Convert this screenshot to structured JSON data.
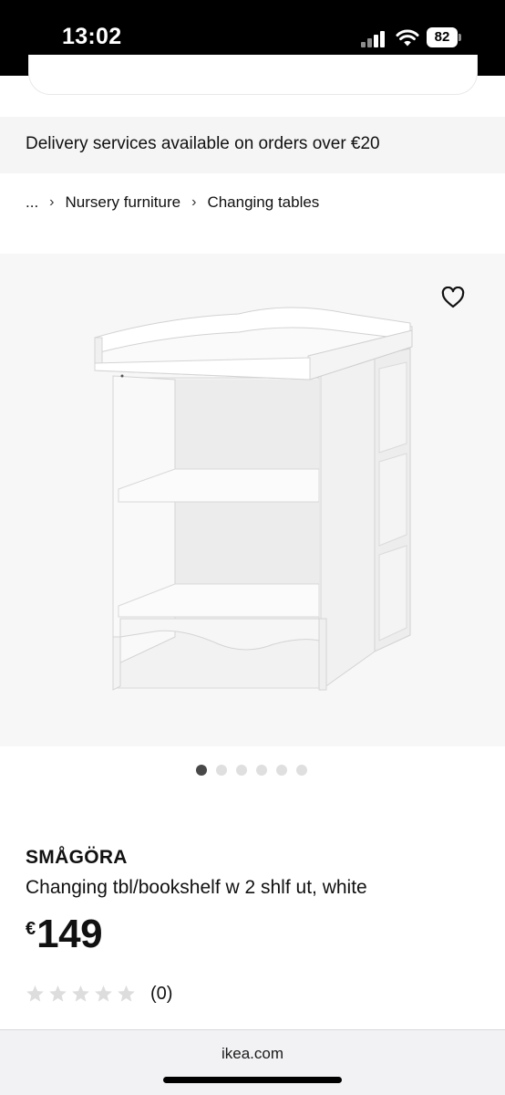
{
  "status_bar": {
    "time": "13:02",
    "battery": "82",
    "icons": [
      "signal-icon",
      "wifi-icon",
      "battery-icon"
    ]
  },
  "delivery_banner": {
    "text": "Delivery services available on orders over €20"
  },
  "breadcrumb": {
    "ellipsis": "...",
    "items": [
      "Nursery furniture",
      "Changing tables"
    ],
    "separator_icon": "chevron-right-icon"
  },
  "product": {
    "wishlist_icon": "heart-icon",
    "carousel": {
      "total": 6,
      "active": 1
    },
    "name": "SMÅGÖRA",
    "description": "Changing tbl/bookshelf w 2 shlf ut, white",
    "price": {
      "currency": "€",
      "amount": "149"
    },
    "rating": {
      "stars": 0,
      "max_stars": 5,
      "count_label": "(0)"
    }
  },
  "browser": {
    "url": "ikea.com"
  },
  "colors": {
    "status_bar_bg": "#000000",
    "banner_bg": "#f5f5f5",
    "image_bg": "#f7f7f7",
    "dot_active": "#484848",
    "dot_inactive": "#dfdfdf",
    "star_empty": "#dddddd"
  }
}
